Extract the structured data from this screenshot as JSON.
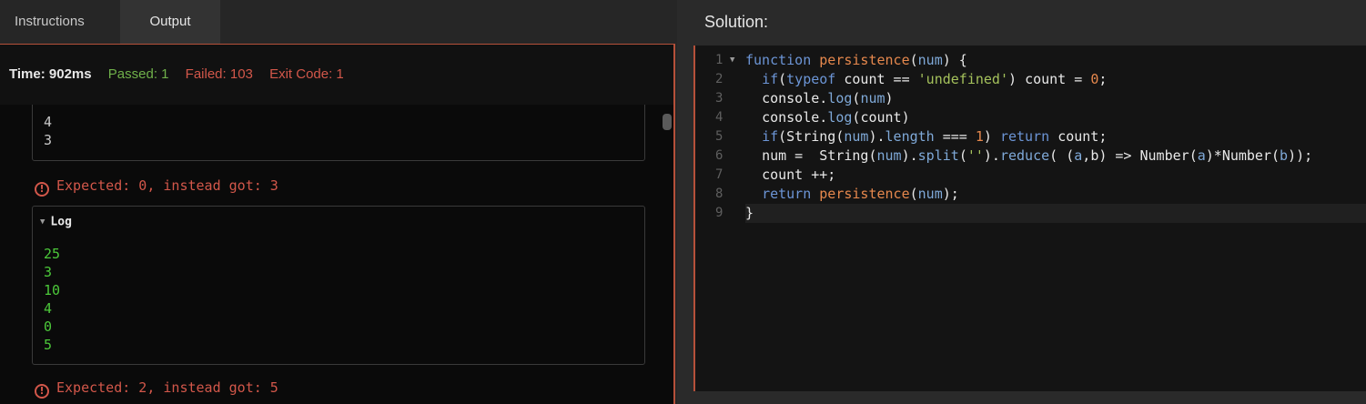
{
  "tabs": {
    "instructions": "Instructions",
    "output": "Output"
  },
  "stats": {
    "time": "Time: 902ms",
    "passed": "Passed: 1",
    "failed": "Failed: 103",
    "exit": "Exit Code: 1"
  },
  "results": {
    "first_log_lines": [
      "4",
      "3"
    ],
    "error1": "Expected: 0, instead got: 3",
    "log_title": "Log",
    "log_lines": [
      "25",
      "3",
      "10",
      "4",
      "0",
      "5"
    ],
    "error2": "Expected: 2, instead got: 5"
  },
  "solution": {
    "title": "Solution:",
    "line_numbers": [
      "1",
      "2",
      "3",
      "4",
      "5",
      "6",
      "7",
      "8",
      "9"
    ],
    "code_lines": [
      "function persistence(num) {",
      "  if(typeof count == 'undefined') count = 0;",
      "  console.log(num)",
      "  console.log(count)",
      "  if(String(num).length === 1) return count;",
      "  num =  String(num).split('').reduce( (a,b) => Number(a)*Number(b));",
      "  count ++;",
      "  return persistence(num);",
      "}"
    ]
  },
  "icons": {
    "error": "exclamation-circle-icon",
    "fold": "triangle-down-icon"
  },
  "colors": {
    "accent": "#b5503a",
    "passed": "#6fb04a",
    "failed": "#d2574a",
    "log_text": "#4cc93a"
  }
}
